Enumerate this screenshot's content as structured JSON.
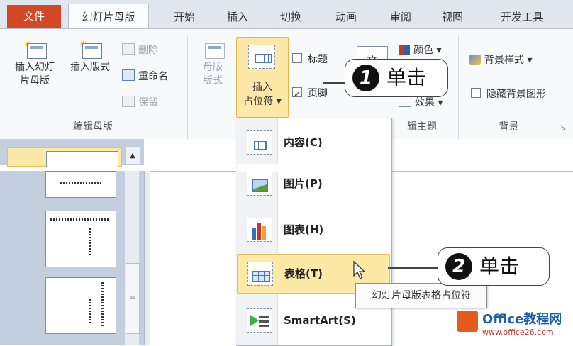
{
  "tabs": {
    "file": "文件",
    "master": "幻灯片母版",
    "home": "开始",
    "insert": "插入",
    "transitions": "切换",
    "animations": "动画",
    "review": "审阅",
    "view": "视图",
    "developer": "开发工具"
  },
  "ribbon": {
    "edit_master": {
      "label": "编辑母版",
      "insert_slide_master": [
        "插入幻灯",
        "片母版"
      ],
      "insert_layout": "插入版式",
      "delete": "删除",
      "rename": "重命名",
      "preserve": "保留"
    },
    "master_layout": {
      "master_layout_btn": [
        "母版",
        "版式"
      ],
      "insert_placeholder": [
        "插入",
        "占位符 ▾"
      ],
      "title_check": "标题",
      "footer_check": "页脚"
    },
    "edit_theme": {
      "label": "辑主题",
      "theme_glyph": "文",
      "colors": "颜色 ▾",
      "fonts_partial": "效果 ▾"
    },
    "background": {
      "label": "背景",
      "bg_styles": "背景样式 ▾",
      "hide_bg": "隐藏背景图形"
    }
  },
  "callouts": [
    {
      "num": "1",
      "text": "单击"
    },
    {
      "num": "2",
      "text": "单击"
    }
  ],
  "menu": {
    "items": [
      {
        "label": "内容(C)"
      },
      {
        "label": "图片(P)"
      },
      {
        "label": "图表(H)"
      },
      {
        "label": "表格(T)"
      },
      {
        "label": "SmartArt(S)"
      }
    ]
  },
  "tooltip": "幻灯片母版表格占位符",
  "watermark": {
    "brand": "Office教程网",
    "url": "www.office26.com"
  },
  "colors": {
    "file_tab": "#d24726",
    "highlight": "#fde9a6",
    "thumb_pane": "#c3cfde"
  }
}
